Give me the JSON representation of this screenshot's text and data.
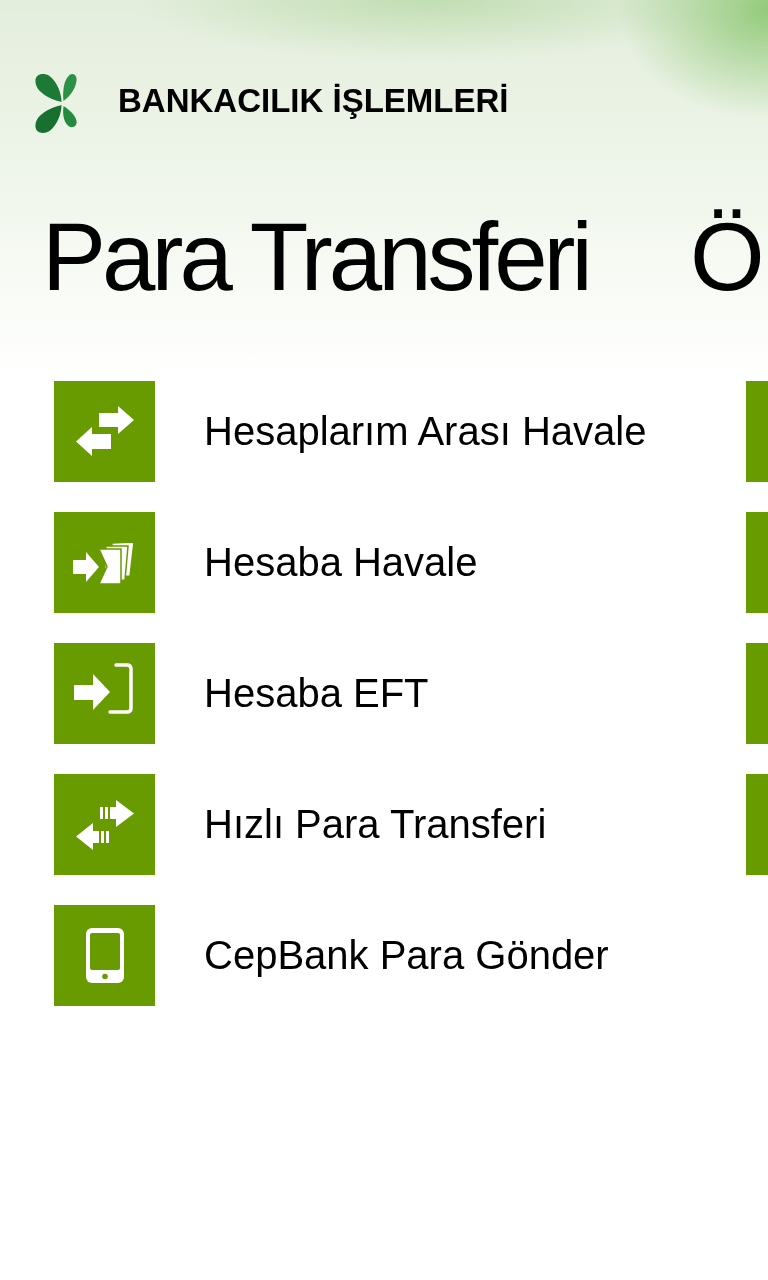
{
  "header": {
    "title": "BANKACILIK İŞLEMLERİ"
  },
  "section": {
    "title": "Para Transferi",
    "items": [
      {
        "label": "Hesaplarım Arası Havale"
      },
      {
        "label": "Hesaba Havale"
      },
      {
        "label": "Hesaba EFT"
      },
      {
        "label": "Hızlı Para Transferi"
      },
      {
        "label": "CepBank Para Gönder"
      }
    ]
  },
  "next_section": {
    "title": "Ö",
    "items": [
      {
        "kind": "tile"
      },
      {
        "kind": "tile"
      },
      {
        "kind": "tile"
      },
      {
        "kind": "tile"
      }
    ]
  }
}
